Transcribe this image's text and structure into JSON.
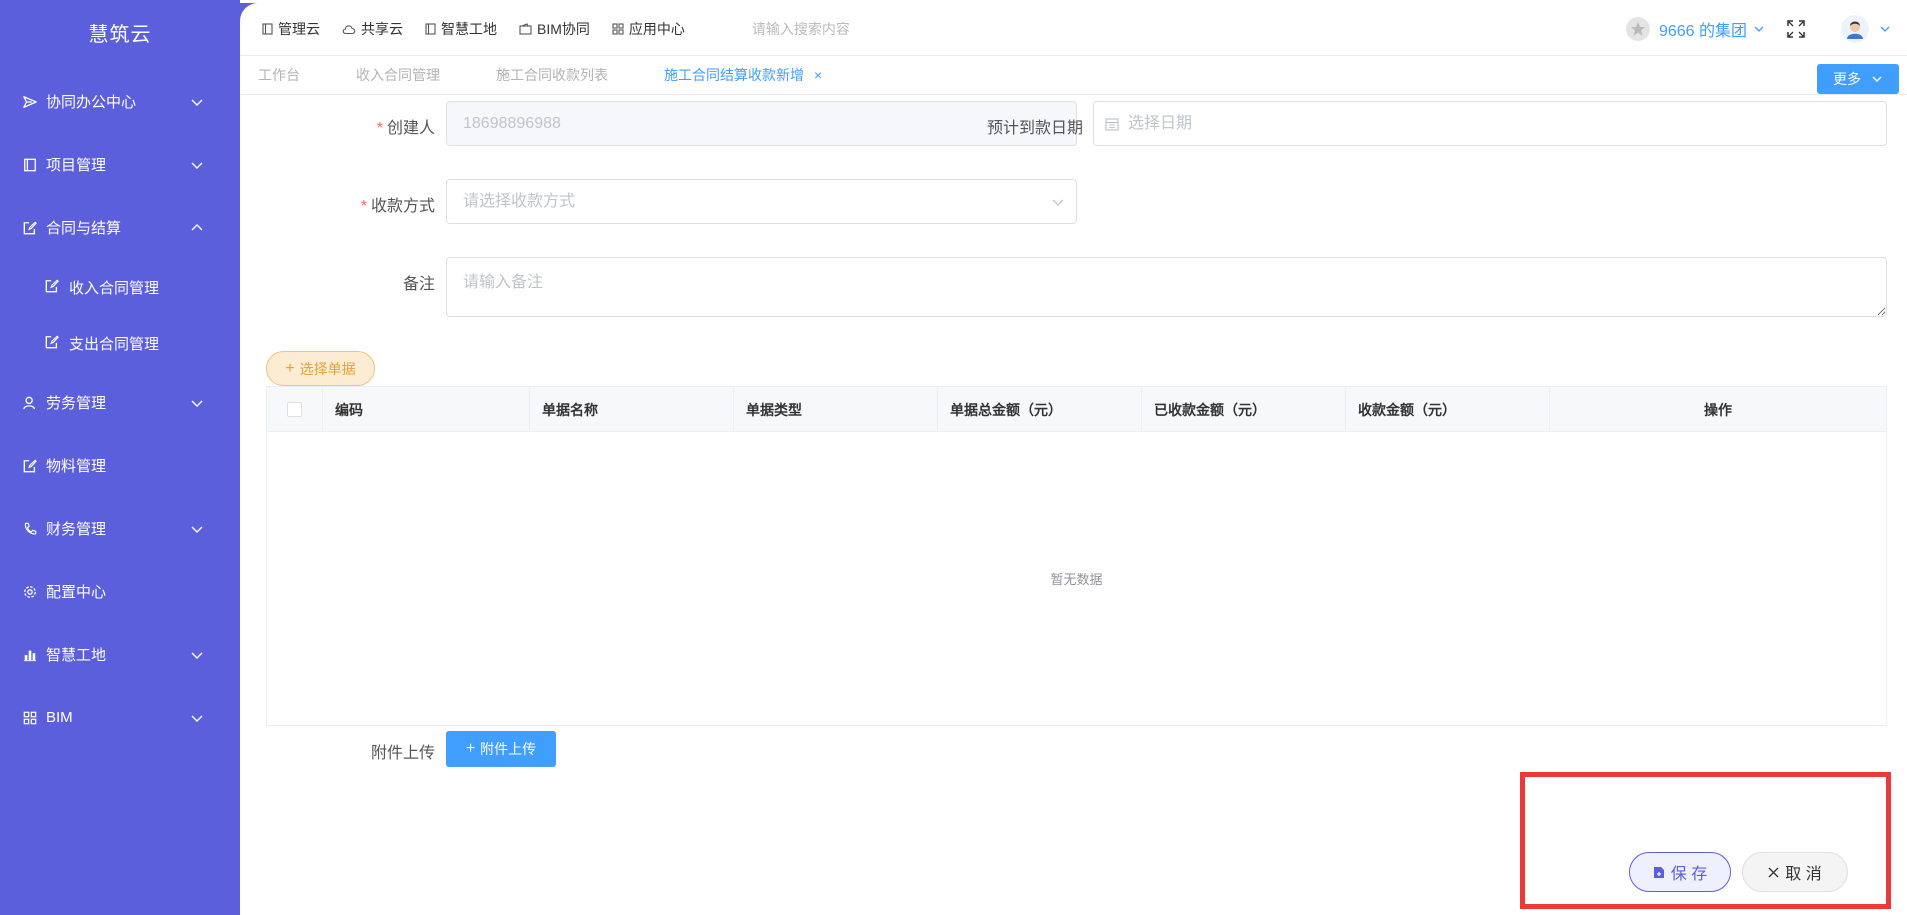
{
  "app": {
    "brand": "慧筑云"
  },
  "sidebar": {
    "items": [
      {
        "label": "协同办公中心",
        "icon": "send-icon",
        "expandable": true
      },
      {
        "label": "项目管理",
        "icon": "book-icon",
        "expandable": true
      },
      {
        "label": "合同与结算",
        "icon": "edit-icon",
        "expandable": true,
        "expanded": true,
        "children": [
          {
            "label": "收入合同管理"
          },
          {
            "label": "支出合同管理"
          }
        ]
      },
      {
        "label": "劳务管理",
        "icon": "user-icon",
        "expandable": true
      },
      {
        "label": "物料管理",
        "icon": "edit-icon",
        "expandable": false
      },
      {
        "label": "财务管理",
        "icon": "phone-icon",
        "expandable": true
      },
      {
        "label": "配置中心",
        "icon": "gear-icon",
        "expandable": false
      },
      {
        "label": "智慧工地",
        "icon": "bar-chart-icon",
        "expandable": true
      },
      {
        "label": "BIM",
        "icon": "grid-icon",
        "expandable": true
      }
    ]
  },
  "topnav": {
    "links": [
      "管理云",
      "共享云",
      "智慧工地",
      "BIM协同",
      "应用中心"
    ],
    "search_placeholder": "请输入搜索内容",
    "org": "9666 的集团"
  },
  "tabs": {
    "items": [
      "工作台",
      "收入合同管理",
      "施工合同收款列表"
    ],
    "active": "施工合同结算收款新增",
    "close": "×",
    "more": "更多"
  },
  "form": {
    "creator": {
      "label": "创建人",
      "value": "18698896988"
    },
    "expected_date": {
      "label": "预计到款日期",
      "placeholder": "选择日期"
    },
    "payment_method": {
      "label": "收款方式",
      "placeholder": "请选择收款方式"
    },
    "remark": {
      "label": "备注",
      "placeholder": "请输入备注"
    },
    "select_doc": "选择单据",
    "attachment": {
      "label": "附件上传",
      "button": "附件上传"
    }
  },
  "table": {
    "columns": [
      "编码",
      "单据名称",
      "单据类型",
      "单据总金额（元）",
      "已收款金额（元）",
      "收款金额（元）",
      "操作"
    ],
    "empty_text": "暂无数据"
  },
  "actions": {
    "save": "保 存",
    "cancel": "取 消"
  },
  "colors": {
    "sidebar": "#5b5fdc",
    "primary": "#409eff",
    "warning": "#e6a23c",
    "highlight": "#e93939"
  }
}
